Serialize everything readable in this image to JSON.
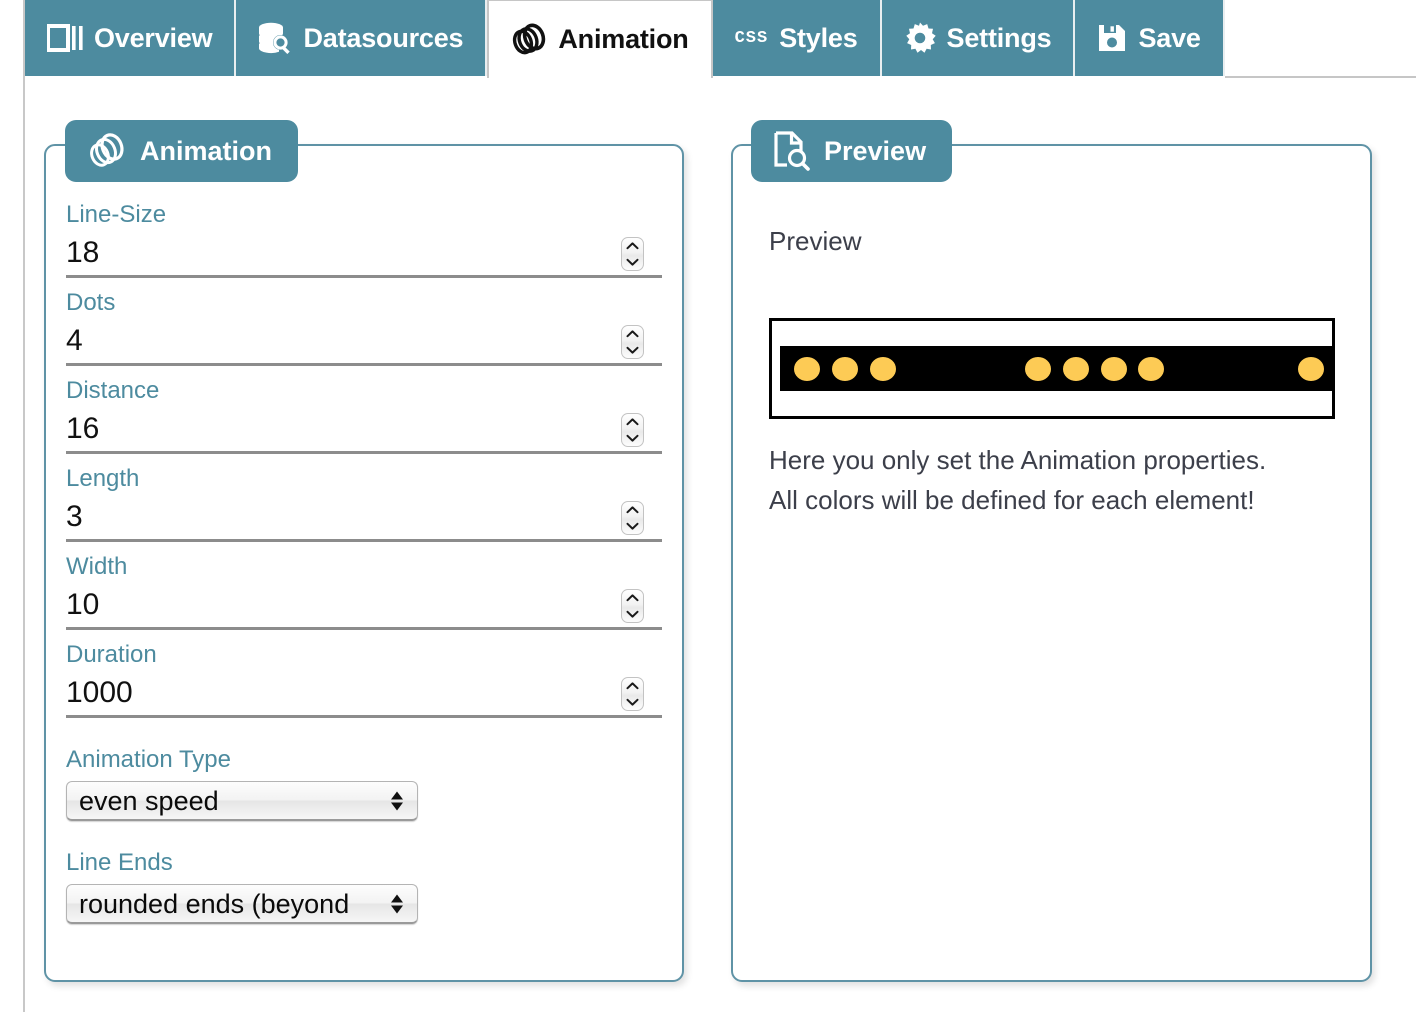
{
  "tabs": [
    {
      "id": "overview",
      "label": "Overview",
      "icon": "layout-columns-icon",
      "active": false
    },
    {
      "id": "datasources",
      "label": "Datasources",
      "icon": "database-search-icon",
      "active": false
    },
    {
      "id": "animation",
      "label": "Animation",
      "icon": "animation-rings-icon",
      "active": true
    },
    {
      "id": "styles",
      "label": "Styles",
      "icon": "css-text-icon",
      "active": false
    },
    {
      "id": "settings",
      "label": "Settings",
      "icon": "gear-icon",
      "active": false
    },
    {
      "id": "save",
      "label": "Save",
      "icon": "floppy-disk-icon",
      "active": false
    }
  ],
  "animation_panel": {
    "header": "Animation",
    "header_icon": "animation-rings-icon",
    "number_fields": [
      {
        "id": "line-size",
        "label": "Line-Size",
        "value": "18"
      },
      {
        "id": "dots",
        "label": "Dots",
        "value": "4"
      },
      {
        "id": "distance",
        "label": "Distance",
        "value": "16"
      },
      {
        "id": "length",
        "label": "Length",
        "value": "3"
      },
      {
        "id": "width",
        "label": "Width",
        "value": "10"
      },
      {
        "id": "duration",
        "label": "Duration",
        "value": "1000"
      }
    ],
    "selects": [
      {
        "id": "animation-type",
        "label": "Animation Type",
        "value": "even speed"
      },
      {
        "id": "line-ends",
        "label": "Line Ends",
        "value": "rounded ends (beyond"
      }
    ]
  },
  "preview_panel": {
    "header": "Preview",
    "header_icon": "document-search-icon",
    "title": "Preview",
    "note_line_1": "Here you only set the Animation properties.",
    "note_line_2": "All colors will be defined for each element!",
    "strip": {
      "background_color": "#000000",
      "dot_color": "#FDCB55",
      "dot_width": 26,
      "dot_height": 24,
      "dot_centers_x": [
        27,
        65,
        103,
        258,
        296,
        334,
        371,
        531
      ]
    }
  },
  "colors": {
    "tab_teal": "#4D8B9F",
    "panel_border": "#5F93A6",
    "label_blue": "#4D8B9F",
    "value_black": "#111111",
    "text_gray": "#3C3F4A",
    "dot_yellow": "#FDCB55",
    "strip_black": "#000000"
  }
}
